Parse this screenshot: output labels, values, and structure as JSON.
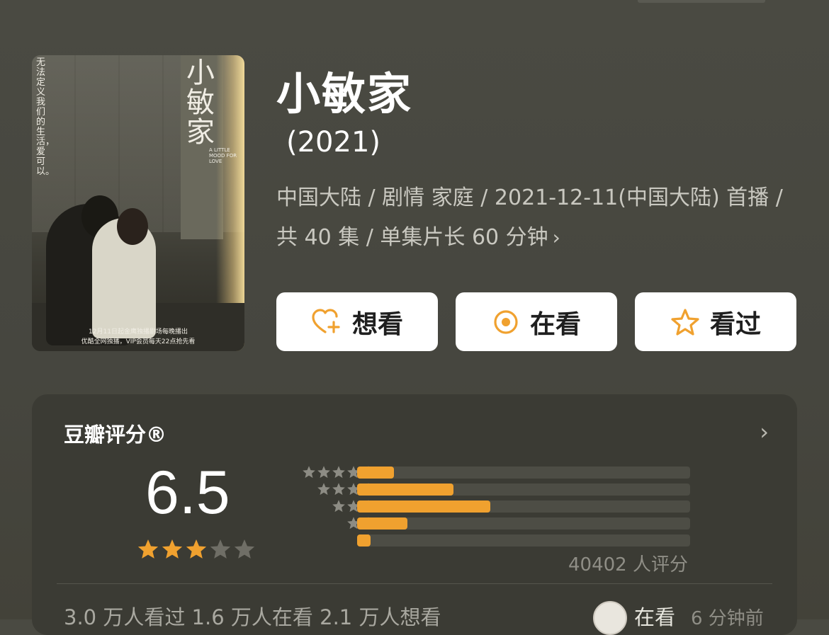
{
  "poster": {
    "vertical_text": "无法定义我们的生活，爱可以。",
    "title": "小敏家",
    "subtitle": "A LITTLE MOOD FOR LOVE",
    "bottom_line1": "12月11日起金鹰独播剧场每晚播出",
    "bottom_line2": "优酷全网独播，VIP会员每天22点抢先看"
  },
  "show": {
    "title": "小敏家",
    "year": "(2021)",
    "meta": "中国大陆 / 剧情 家庭 / 2021-12-11(中国大陆) 首播 / 共 40 集 / 单集片长 60 分钟"
  },
  "actions": [
    {
      "label": "想看",
      "icon": "heart-plus-icon"
    },
    {
      "label": "在看",
      "icon": "target-icon"
    },
    {
      "label": "看过",
      "icon": "star-outline-icon"
    }
  ],
  "colors": {
    "accent": "#f0a12f",
    "background": "#46463f",
    "card": "#3b3b34"
  },
  "rating": {
    "title": "豆瓣评分®",
    "score": "6.5",
    "stars_filled": 3,
    "stars_total": 5,
    "distribution": [
      {
        "stars": 5,
        "fraction": 0.11
      },
      {
        "stars": 4,
        "fraction": 0.29
      },
      {
        "stars": 3,
        "fraction": 0.4
      },
      {
        "stars": 2,
        "fraction": 0.15
      },
      {
        "stars": 1,
        "fraction": 0.04
      }
    ],
    "count_text": "40402 人评分"
  },
  "footer": {
    "stats": "3.0 万人看过   1.6 万人在看   2.1 万人想看",
    "status": "在看",
    "time": "6 分钟前"
  }
}
